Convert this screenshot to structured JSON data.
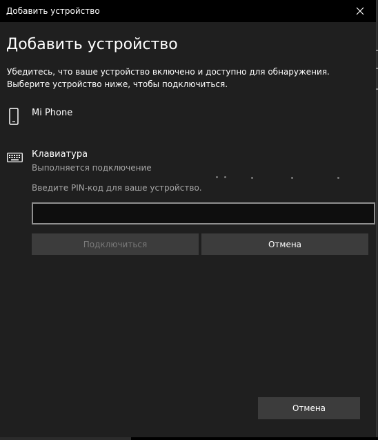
{
  "window": {
    "title": "Добавить устройство"
  },
  "heading": "Добавить устройство",
  "instructions": {
    "line1": "Убедитесь, что ваше устройство включено и доступно для обнаружения.",
    "line2": "Выберите устройство ниже, чтобы подключиться."
  },
  "devices": [
    {
      "name": "Mi Phone",
      "icon": "phone-icon"
    },
    {
      "name": "Клавиатура",
      "icon": "keyboard-icon",
      "status": "Выполняется подключение"
    }
  ],
  "pin": {
    "prompt": "Введите PIN-код для ваше устройство.",
    "value": "",
    "placeholder": ""
  },
  "buttons": {
    "connect": "Подключиться",
    "cancel_inline": "Отмена",
    "cancel_bottom": "Отмена"
  },
  "colors": {
    "background": "#1f1f1f",
    "titlebar": "#000000",
    "button": "#3c3c3c",
    "disabled_text": "#7a7a7a",
    "secondary_text": "#a6a6a6"
  }
}
